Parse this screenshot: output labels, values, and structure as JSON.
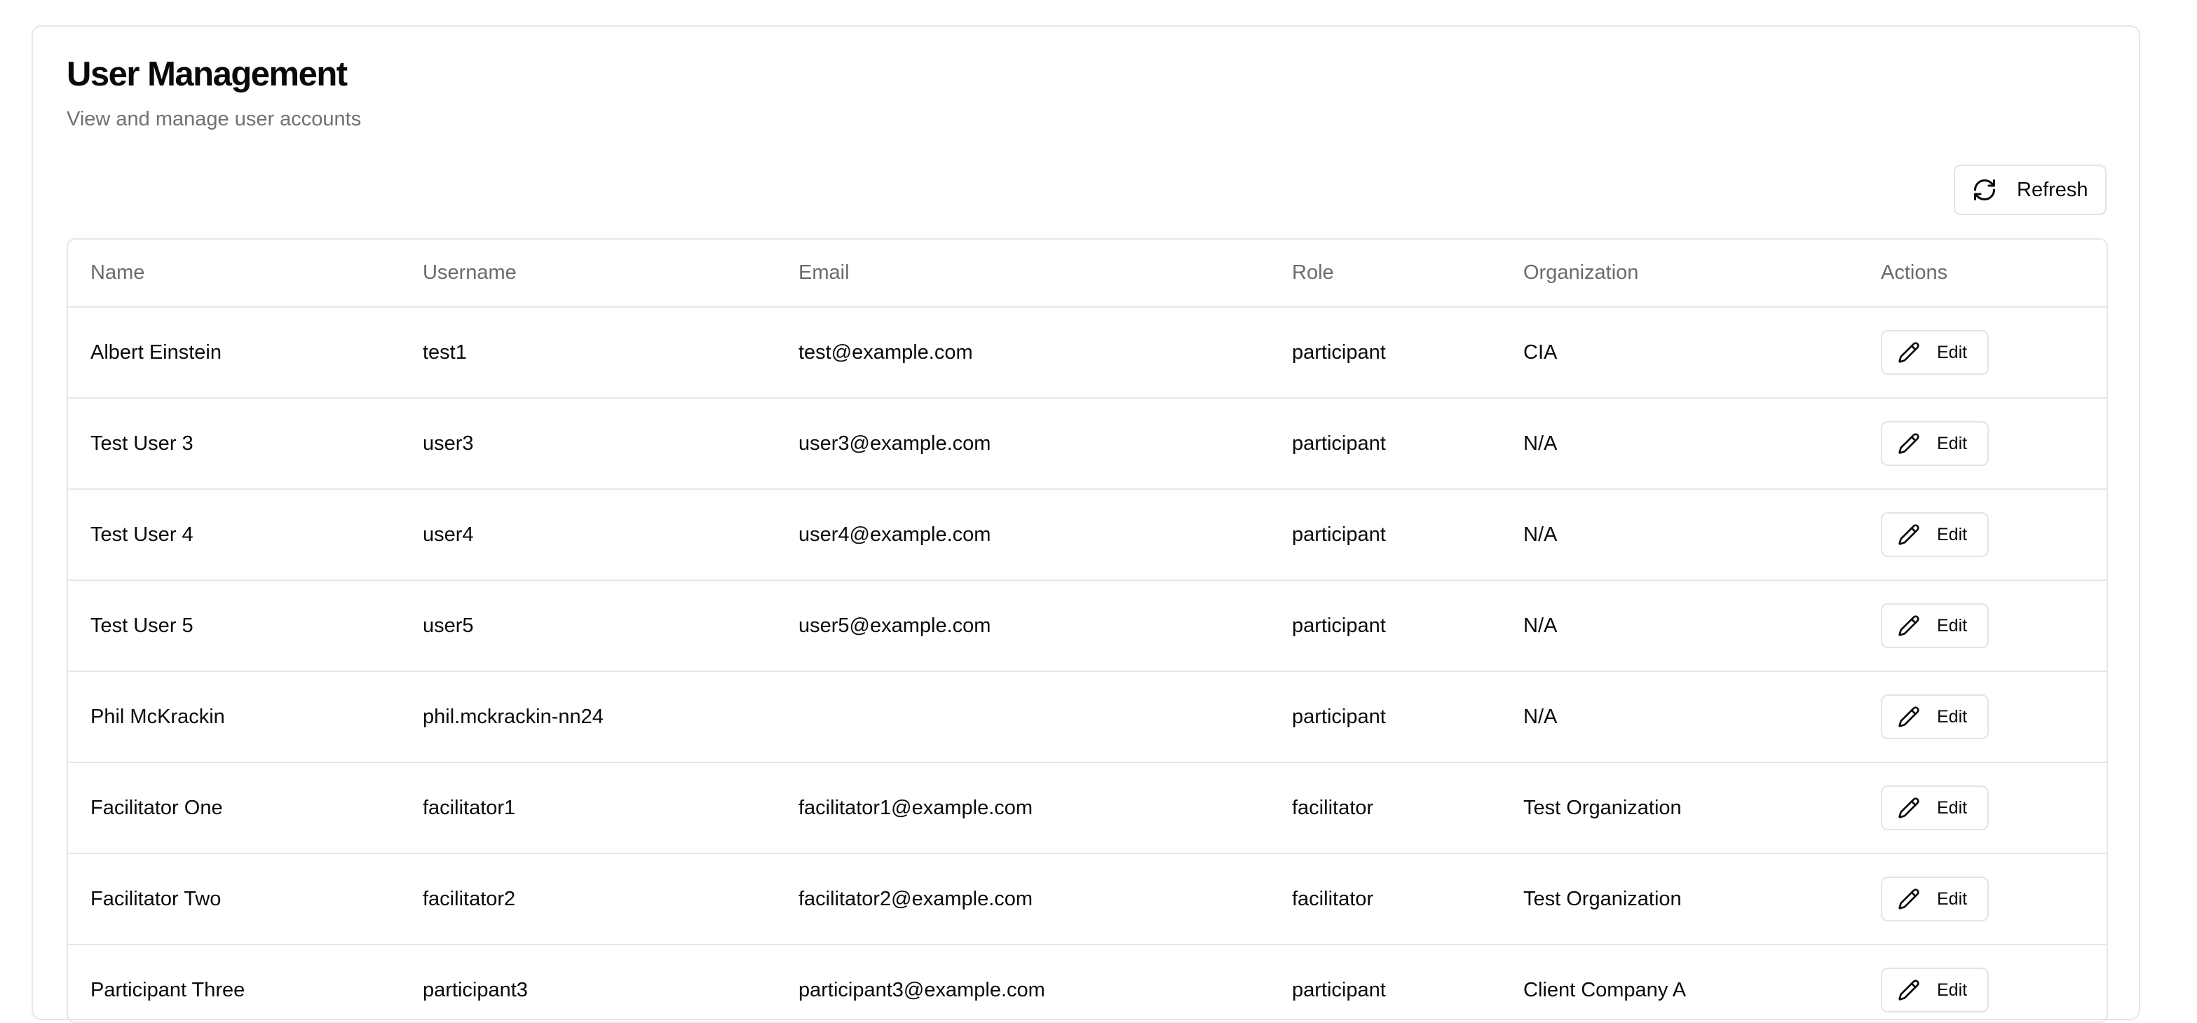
{
  "page": {
    "title": "User Management",
    "subtitle": "View and manage user accounts"
  },
  "toolbar": {
    "refresh_label": "Refresh",
    "refresh_icon": "refresh-icon"
  },
  "table": {
    "columns": [
      "Name",
      "Username",
      "Email",
      "Role",
      "Organization",
      "Actions"
    ],
    "edit_label": "Edit",
    "edit_icon": "pencil-icon",
    "rows": [
      {
        "name": "Albert Einstein",
        "username": "test1",
        "email": "test@example.com",
        "role": "participant",
        "organization": "CIA"
      },
      {
        "name": "Test User 3",
        "username": "user3",
        "email": "user3@example.com",
        "role": "participant",
        "organization": "N/A"
      },
      {
        "name": "Test User 4",
        "username": "user4",
        "email": "user4@example.com",
        "role": "participant",
        "organization": "N/A"
      },
      {
        "name": "Test User 5",
        "username": "user5",
        "email": "user5@example.com",
        "role": "participant",
        "organization": "N/A"
      },
      {
        "name": "Phil McKrackin",
        "username": "phil.mckrackin-nn24",
        "email": "",
        "role": "participant",
        "organization": "N/A"
      },
      {
        "name": "Facilitator One",
        "username": "facilitator1",
        "email": "facilitator1@example.com",
        "role": "facilitator",
        "organization": "Test Organization"
      },
      {
        "name": "Facilitator Two",
        "username": "facilitator2",
        "email": "facilitator2@example.com",
        "role": "facilitator",
        "organization": "Test Organization"
      },
      {
        "name": "Participant Three",
        "username": "participant3",
        "email": "participant3@example.com",
        "role": "participant",
        "organization": "Client Company A"
      }
    ]
  },
  "colors": {
    "text": "#0a0a0a",
    "muted": "#717171",
    "border": "#e6e6e6"
  }
}
